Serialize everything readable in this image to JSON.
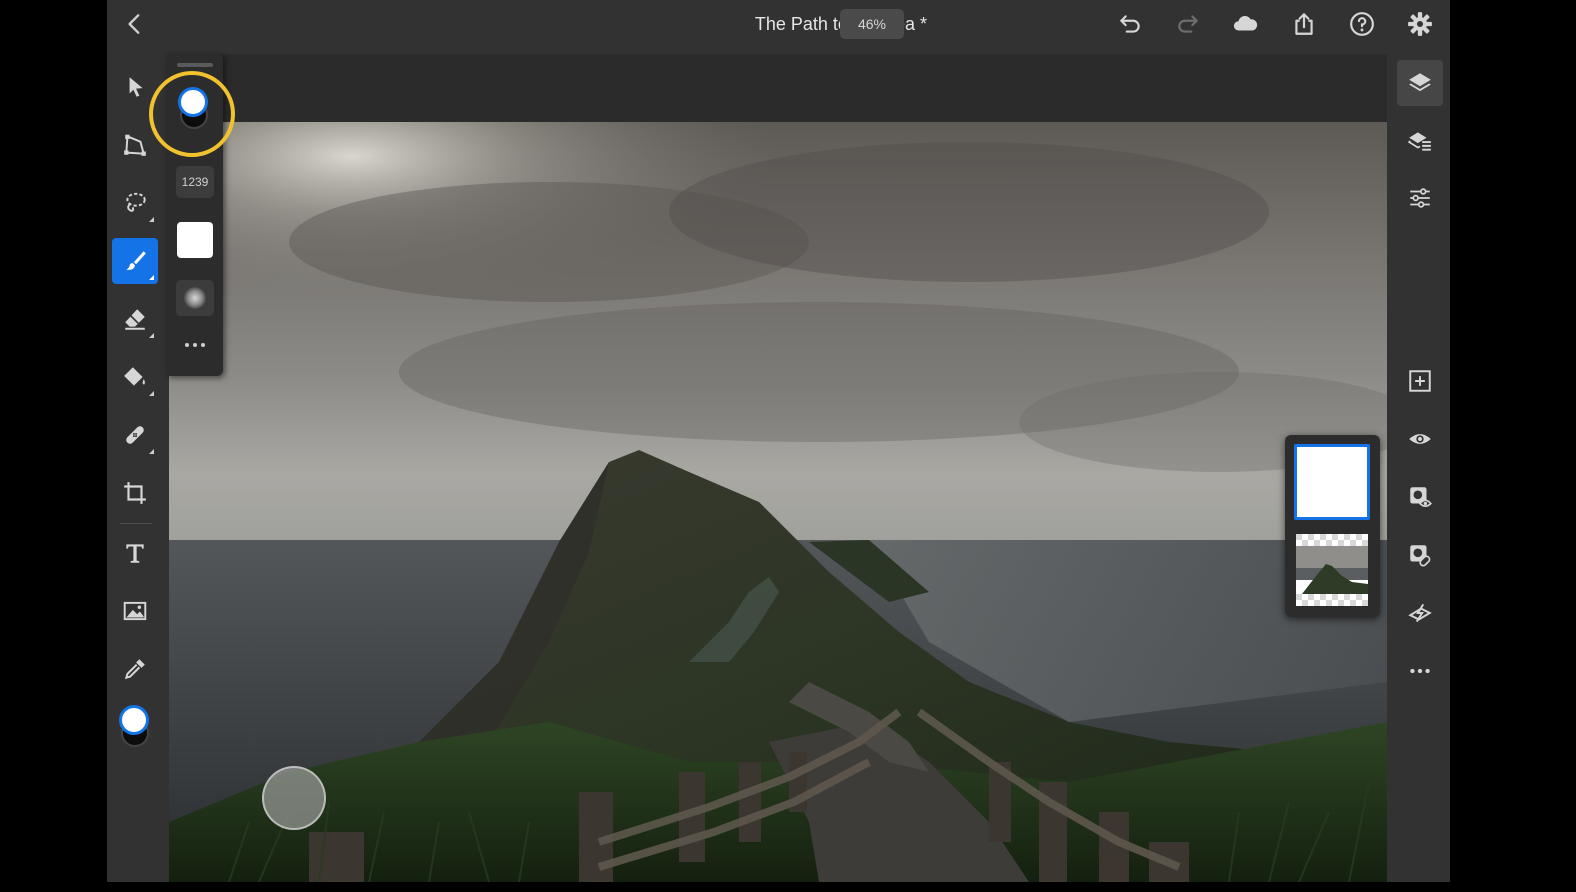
{
  "document": {
    "title": "The Path to the Sea *",
    "zoom": "46%"
  },
  "topbar": {
    "icons": [
      "back-chevron-icon",
      "undo-icon",
      "redo-icon",
      "cloud-icon",
      "share-icon",
      "help-icon",
      "gear-icon"
    ]
  },
  "toolbar": {
    "tools": [
      {
        "name": "select-tool",
        "icon": "arrow-pointer-icon",
        "active": false
      },
      {
        "name": "transform-tool",
        "icon": "transform-icon",
        "active": false
      },
      {
        "name": "lasso-tool",
        "icon": "lasso-icon",
        "active": false
      },
      {
        "name": "brush-tool",
        "icon": "brush-icon",
        "active": true
      },
      {
        "name": "eraser-tool",
        "icon": "eraser-icon",
        "active": false
      },
      {
        "name": "fill-tool",
        "icon": "paint-bucket-icon",
        "active": false
      },
      {
        "name": "heal-tool",
        "icon": "bandage-icon",
        "active": false
      },
      {
        "name": "crop-tool",
        "icon": "crop-icon",
        "active": false
      },
      {
        "name": "type-tool",
        "icon": "text-icon",
        "active": false
      },
      {
        "name": "place-image-tool",
        "icon": "image-icon",
        "active": false
      },
      {
        "name": "eyedropper-tool",
        "icon": "eyedropper-icon",
        "active": false
      }
    ],
    "foreground_color": "#ffffff",
    "background_color": "#0c0c0c"
  },
  "brush_flyout": {
    "brush_size": "1239",
    "color": "#ffffff",
    "more": "..."
  },
  "right_panel": {
    "icons": [
      "layers-icon",
      "layer-properties-icon",
      "adjustments-icon",
      "add-layer-icon",
      "visibility-eye-icon",
      "mask-icon",
      "link-mask-icon",
      "fx-icon",
      "more-icon"
    ]
  },
  "layers": [
    {
      "name": "white-layer",
      "selected": true
    },
    {
      "name": "photo-layer",
      "selected": false
    }
  ],
  "colors": {
    "accent": "#1473e6",
    "highlight": "#f2c12e",
    "panel": "#323232"
  }
}
